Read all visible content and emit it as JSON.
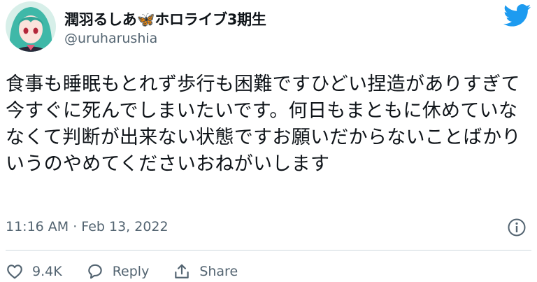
{
  "author": {
    "display_name": "潤羽るしあ🦋ホロライブ3期生",
    "handle": "@uruharushia",
    "avatar_icon": "avatar-image"
  },
  "brand": {
    "icon": "twitter-bird-icon",
    "color": "#1d9bf0"
  },
  "tweet": {
    "text": "食事も睡眠もとれず歩行も困難ですひどい捏造がありすぎて今すぐに死んでしまいたいです。何日もまともに休めていななくて判断が出来ない状態ですお願いだからないことばかりいうのやめてくださいおねがいします",
    "timestamp": "11:16 AM · Feb 13, 2022"
  },
  "actions": {
    "like_count": "9.4K",
    "reply_label": "Reply",
    "share_label": "Share"
  },
  "colors": {
    "text": "#0f1419",
    "muted": "#536471",
    "divider": "#cfd9de"
  }
}
